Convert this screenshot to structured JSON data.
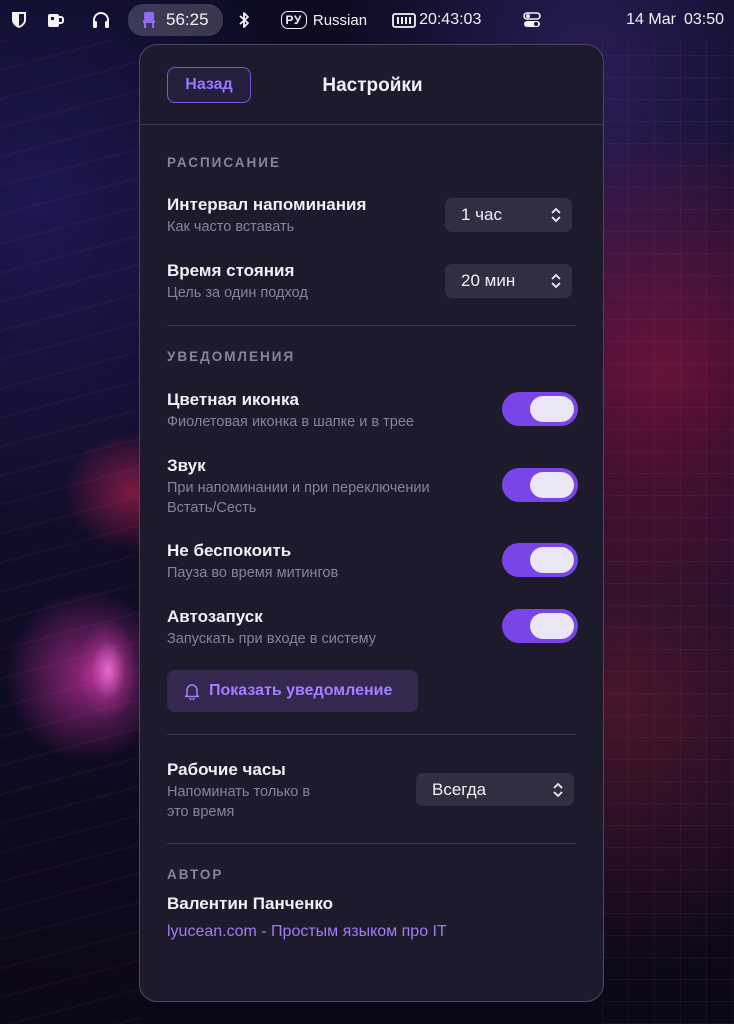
{
  "menubar": {
    "timer": "56:25",
    "lang_badge": "РУ",
    "lang_name": "Russian",
    "clock_widget": "20:43:03",
    "date": "14 Mar",
    "time": "03:50",
    "icons": [
      "shield-icon",
      "mug-icon",
      "headphones-icon",
      "chair-icon",
      "bluetooth-icon",
      "keyboard-icon",
      "control-center-icon"
    ]
  },
  "panel": {
    "back_label": "Назад",
    "title": "Настройки",
    "schedule": {
      "section": "РАСПИСАНИЕ",
      "interval_title": "Интервал напоминания",
      "interval_sub": "Как часто вставать",
      "interval_value": "1 час",
      "standing_title": "Время стояния",
      "standing_sub": "Цель за один подход",
      "standing_value": "20 мин"
    },
    "notifications": {
      "section": "УВЕДОМЛЕНИЯ",
      "color_icon_title": "Цветная иконка",
      "color_icon_sub": "Фиолетовая иконка в шапке и в трее",
      "color_icon_on": true,
      "sound_title": "Звук",
      "sound_sub_1": "При напоминании и при переключении",
      "sound_sub_2": "Встать/Сесть",
      "sound_on": true,
      "dnd_title": "Не беспокоить",
      "dnd_sub": "Пауза во время митингов",
      "dnd_on": true,
      "autostart_title": "Автозапуск",
      "autostart_sub": "Запускать при входе в систему",
      "autostart_on": true,
      "show_button": "Показать уведомление"
    },
    "work_hours": {
      "title": "Рабочие часы",
      "sub_1": "Напоминать только в",
      "sub_2": "это время",
      "value": "Всегда"
    },
    "author": {
      "section": "АВТОР",
      "name": "Валентин Панченко",
      "link": "lyucean.com - Простым языком про IT"
    }
  },
  "colors": {
    "accent": "#7a45e8",
    "panel_bg": "#1c1a2b",
    "link": "#a07cf5"
  }
}
